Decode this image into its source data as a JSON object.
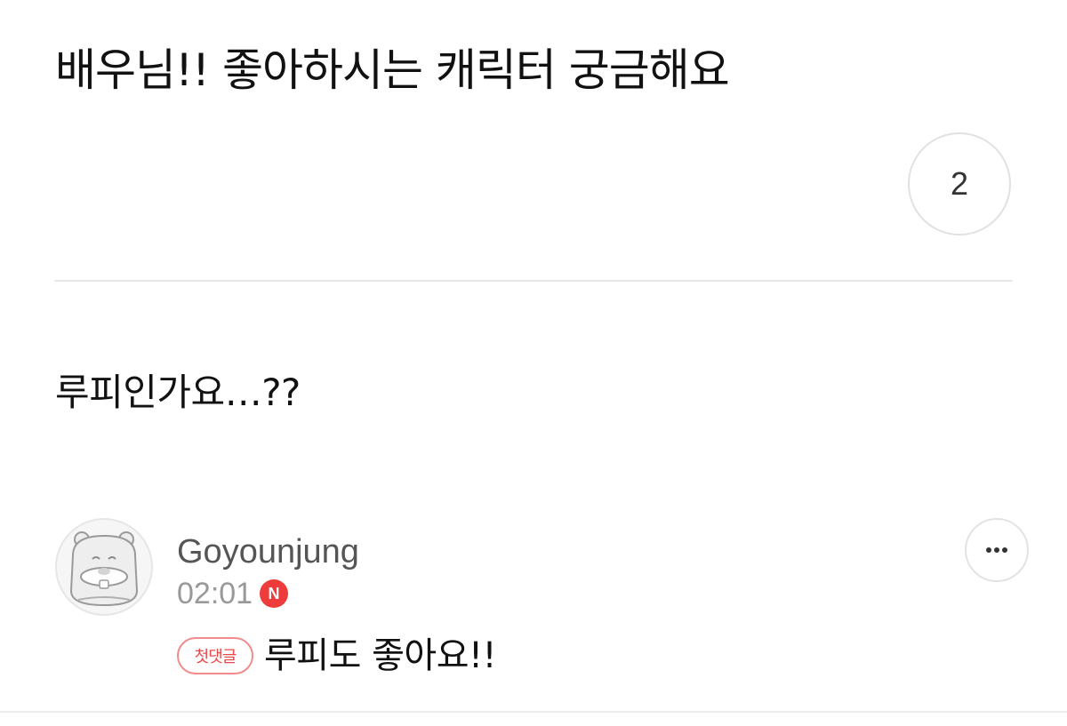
{
  "post": {
    "title": "배우님!! 좋아하시는 캐릭터 궁금해요",
    "comment_count": "2",
    "body": "루피인가요…??"
  },
  "comment": {
    "author": "Goyounjung",
    "time": "02:01",
    "new_badge": "N",
    "first_comment_badge": "첫댓글",
    "text": "루피도 좋아요!!",
    "avatar_icon": "beaver-character-avatar-icon",
    "more_icon": "more-options-icon"
  },
  "colors": {
    "new_badge": "#ee3b3b",
    "first_comment_badge": "#e84848",
    "divider": "#e8e8e8"
  }
}
